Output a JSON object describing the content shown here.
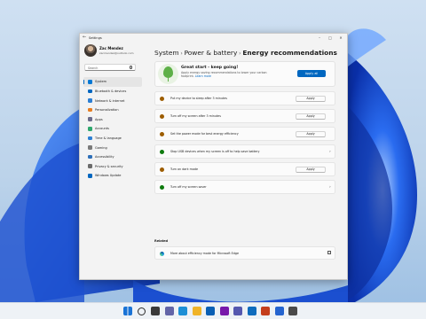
{
  "window": {
    "title": "Settings",
    "back_glyph": "←",
    "minimize_glyph": "–",
    "maximize_glyph": "□",
    "close_glyph": "✕"
  },
  "profile": {
    "name": "Zac Mendez",
    "email": "zacmendez@outlook.com"
  },
  "search": {
    "placeholder": "Search"
  },
  "sidebar": {
    "items": [
      {
        "label": "System",
        "icon": "system-icon",
        "color": "#0078d4",
        "active": true
      },
      {
        "label": "Bluetooth & devices",
        "icon": "bluetooth-icon",
        "color": "#0067c0"
      },
      {
        "label": "Network & internet",
        "icon": "network-icon",
        "color": "#2d7fd3"
      },
      {
        "label": "Personalization",
        "icon": "brush-icon",
        "color": "#e67e22"
      },
      {
        "label": "Apps",
        "icon": "apps-icon",
        "color": "#6b6b8a"
      },
      {
        "label": "Accounts",
        "icon": "accounts-icon",
        "color": "#2fa86e"
      },
      {
        "label": "Time & language",
        "icon": "globe-icon",
        "color": "#2d7fd3"
      },
      {
        "label": "Gaming",
        "icon": "gaming-icon",
        "color": "#7a7a7a"
      },
      {
        "label": "Accessibility",
        "icon": "accessibility-icon",
        "color": "#2d6fb8"
      },
      {
        "label": "Privacy & security",
        "icon": "shield-icon",
        "color": "#6b6b6b"
      },
      {
        "label": "Windows Update",
        "icon": "windows-update-icon",
        "color": "#0067c0"
      }
    ]
  },
  "breadcrumb": {
    "items": [
      "System",
      "Power & battery",
      "Energy recommendations"
    ],
    "separator": "›"
  },
  "hero": {
    "title": "Great start - keep going!",
    "description": "Apply energy saving recommendations to lower your carbon footprint.",
    "link": "Learn more",
    "apply_all_label": "Apply all"
  },
  "recommendations": [
    {
      "label": "Put my device to sleep after 3 minutes",
      "status": "warn",
      "action": "Apply"
    },
    {
      "label": "Turn off my screen after 3 minutes",
      "status": "warn",
      "action": "Apply"
    },
    {
      "label": "Set the power mode for best energy efficiency",
      "status": "warn",
      "action": "Apply"
    },
    {
      "label": "Stop USB devices when my screen is off to help save battery",
      "status": "done",
      "action": ""
    },
    {
      "label": "Turn on dark mode",
      "status": "warn",
      "action": "Apply"
    },
    {
      "label": "Turn off my screen saver",
      "status": "done",
      "action": ""
    }
  ],
  "chevron_glyph": "›",
  "related": {
    "heading": "Related",
    "item_label": "More about efficiency mode for Microsoft Edge"
  },
  "colors": {
    "accent": "#0067c0",
    "warn": "#9d5d00",
    "success": "#0f7b0f",
    "leaf": "#5db047"
  },
  "taskbar": {
    "icons": [
      {
        "name": "start-icon",
        "color": "#1a73d6"
      },
      {
        "name": "search-icon",
        "color": "#2a2a2a"
      },
      {
        "name": "task-view-icon",
        "color": "#3a3a3a"
      },
      {
        "name": "chat-icon",
        "color": "#6264a7"
      },
      {
        "name": "edge-icon",
        "color": "#1d8fd6"
      },
      {
        "name": "file-explorer-icon",
        "color": "#f0b429"
      },
      {
        "name": "store-icon",
        "color": "#0a5fb4"
      },
      {
        "name": "onenote-icon",
        "color": "#7719aa"
      },
      {
        "name": "teams-icon",
        "color": "#5558af"
      },
      {
        "name": "outlook-icon",
        "color": "#0f6cbd"
      },
      {
        "name": "powerpoint-icon",
        "color": "#c43e1c"
      },
      {
        "name": "todo-icon",
        "color": "#2564cf"
      },
      {
        "name": "settings-icon",
        "color": "#4a4a4a"
      }
    ]
  }
}
